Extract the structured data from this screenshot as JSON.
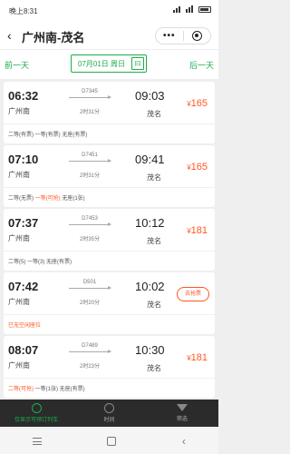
{
  "status": {
    "time": "晚上8:31"
  },
  "header": {
    "title": "广州南-茂名",
    "more": "•••"
  },
  "datebar": {
    "prev": "前一天",
    "date": "07月01日 周日",
    "cal": "曰",
    "next": "后一天"
  },
  "trains": [
    {
      "dep_time": "06:32",
      "dep_station": "广州南",
      "train_no": "D7345",
      "duration": "2时31分",
      "arr_time": "09:03",
      "arr_station": "茂名",
      "price": "165",
      "yen": "¥",
      "seats": [
        "二等(有票)",
        " 一等(有票) ",
        "无座(有票)"
      ],
      "seat_warn": [
        false,
        false,
        false
      ]
    },
    {
      "dep_time": "07:10",
      "dep_station": "广州南",
      "train_no": "D7451",
      "duration": "2时31分",
      "arr_time": "09:41",
      "arr_station": "茂名",
      "price": "165",
      "yen": "¥",
      "seats": [
        "二等(无票)",
        " 一等(可抢) ",
        "无座(1张)"
      ],
      "seat_warn": [
        false,
        true,
        false
      ]
    },
    {
      "dep_time": "07:37",
      "dep_station": "广州南",
      "train_no": "D7453",
      "duration": "2时35分",
      "arr_time": "10:12",
      "arr_station": "茂名",
      "price": "181",
      "yen": "¥",
      "seats": [
        "二等(5)",
        " 一等(3) ",
        "无座(有票)"
      ],
      "seat_warn": [
        false,
        false,
        false
      ]
    },
    {
      "dep_time": "07:42",
      "dep_station": "广州南",
      "train_no": "D501",
      "duration": "2时20分",
      "arr_time": "10:02",
      "arr_station": "茂名",
      "button": "去抢票",
      "seats": [
        "已无空闲座位"
      ],
      "seat_warn": [
        true
      ]
    },
    {
      "dep_time": "08:07",
      "dep_station": "广州南",
      "train_no": "D7489",
      "duration": "2时23分",
      "arr_time": "10:30",
      "arr_station": "茂名",
      "price": "181",
      "yen": "¥",
      "seats": [
        "二等(可抢)",
        " 一等(1张) ",
        "无座(有票)"
      ],
      "seat_warn": [
        true,
        false,
        false
      ]
    }
  ],
  "bottom": {
    "tab1": "仅显示可预订列车",
    "tab2": "时间",
    "tab3": "筛选"
  }
}
